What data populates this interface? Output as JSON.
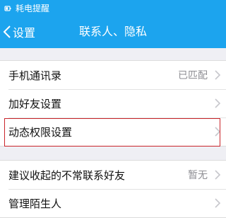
{
  "status_bar": {
    "text": "耗电提醒",
    "icon": "battery-alert-icon"
  },
  "nav": {
    "back_label": "设置",
    "title": "联系人、隐私"
  },
  "group1": {
    "items": [
      {
        "label": "手机通讯录",
        "value": "已匹配"
      },
      {
        "label": "加好友设置",
        "value": ""
      },
      {
        "label": "动态权限设置",
        "value": ""
      }
    ]
  },
  "group2": {
    "items": [
      {
        "label": "建议收起的不常联系好友",
        "value": "暂无"
      },
      {
        "label": "管理陌生人",
        "value": ""
      }
    ]
  },
  "colors": {
    "header": "#1ca4ee",
    "highlight": "#c9242b",
    "background": "#efeff4"
  }
}
